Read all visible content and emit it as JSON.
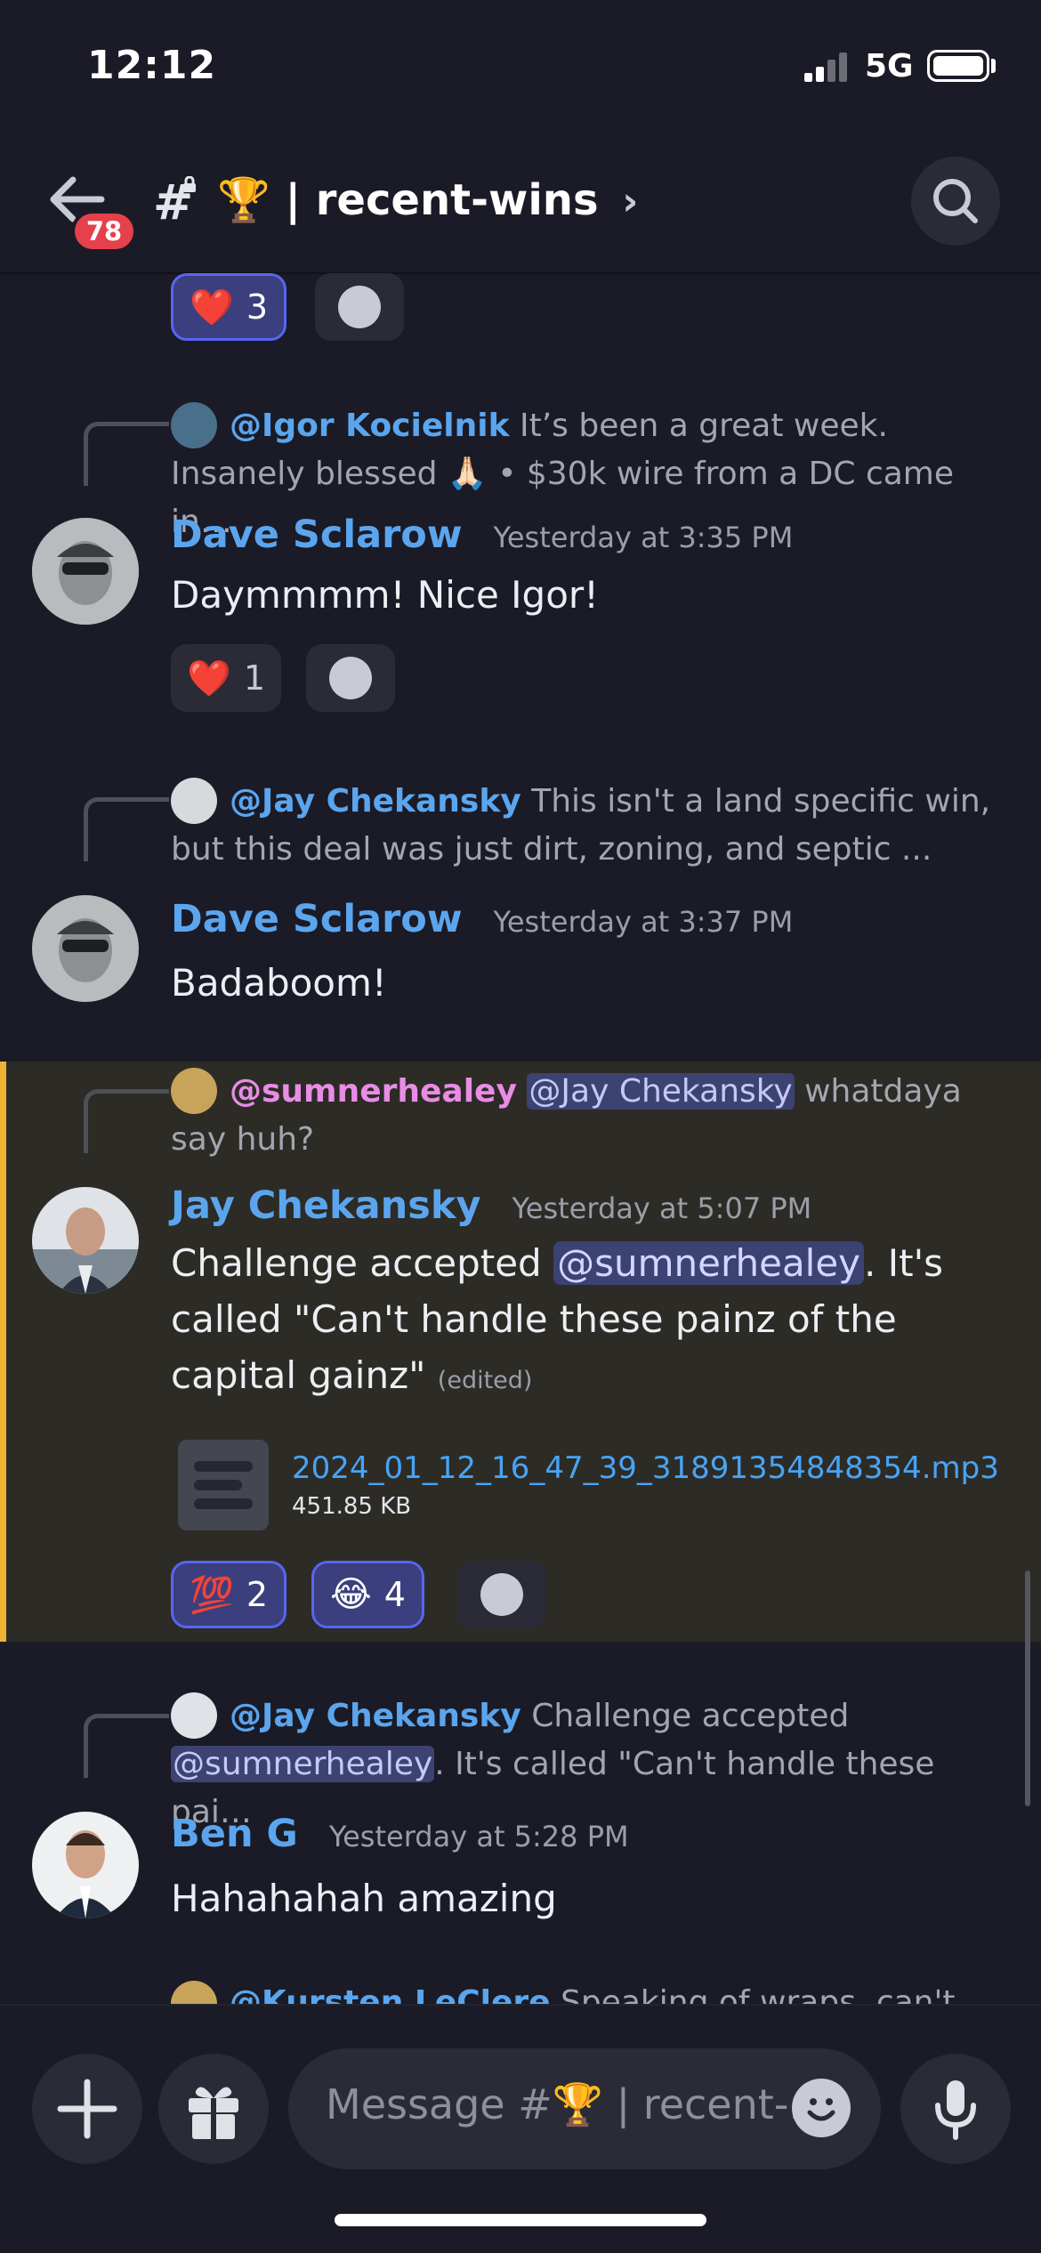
{
  "status_bar": {
    "time": "12:12",
    "network": "5G"
  },
  "header": {
    "unread_count": "78",
    "channel_hash": "#",
    "channel_name": "🏆 | recent-wins",
    "chevron": "›"
  },
  "messages": [
    {
      "reactions": [
        {
          "emoji": "❤️",
          "count": "3",
          "active": true
        }
      ]
    },
    {
      "reply": {
        "user": "@Igor Kocielnik",
        "text": "It’s been a great week. Insanely blessed 🙏🏻 • $30k wire from a DC came in…"
      },
      "author": "Dave Sclarow",
      "timestamp": "Yesterday at 3:35 PM",
      "text": "Daymmmm! Nice Igor!",
      "reactions": [
        {
          "emoji": "❤️",
          "count": "1",
          "active": false
        }
      ]
    },
    {
      "reply": {
        "user": "@Jay Chekansky",
        "text": "This isn't a land specific win, but this deal was just dirt, zoning, and septic ..."
      },
      "author": "Dave Sclarow",
      "timestamp": "Yesterday at 3:37 PM",
      "text": "Badaboom!"
    },
    {
      "reply": {
        "user": "@sumnerhealey",
        "mention": "@Jay Chekansky",
        "text": "whatdaya say huh?"
      },
      "author": "Jay Chekansky",
      "timestamp": "Yesterday at 5:07 PM",
      "text_before": "Challenge accepted ",
      "mention": "@sumnerhealey",
      "text_after": ". It's called \"Can't handle these painz of the capital gainz\"",
      "edited": "(edited)",
      "attachment": {
        "file_name": "2024_01_12_16_47_39_31891354848354.mp3",
        "file_size": "451.85 KB"
      },
      "reactions": [
        {
          "emoji": "💯",
          "count": "2",
          "active": true
        },
        {
          "emoji": "😂",
          "count": "4",
          "active": true
        }
      ]
    },
    {
      "reply": {
        "user": "@Jay Chekansky",
        "text_before": "Challenge accepted ",
        "mention": "@sumnerhealey",
        "text_after": ". It's called \"Can't handle these pai…"
      },
      "author": "Ben G",
      "timestamp": "Yesterday at 5:28 PM",
      "text": "Hahahahah amazing"
    },
    {
      "reply": {
        "user": "@Kursten LeClere",
        "text": "Speaking of wraps, can't"
      }
    }
  ],
  "composer": {
    "placeholder": "Message #🏆 | recent-.."
  },
  "colors": {
    "background": "#1a1b26",
    "accent": "#5865f2",
    "username": "#5ba5ee",
    "highlight_bar": "#f0b232",
    "badge": "#e5414b"
  },
  "icons": [
    "back-arrow-icon",
    "lock-icon",
    "search-icon",
    "add-reaction-icon",
    "file-icon",
    "plus-icon",
    "gift-icon",
    "emoji-icon",
    "microphone-icon"
  ]
}
